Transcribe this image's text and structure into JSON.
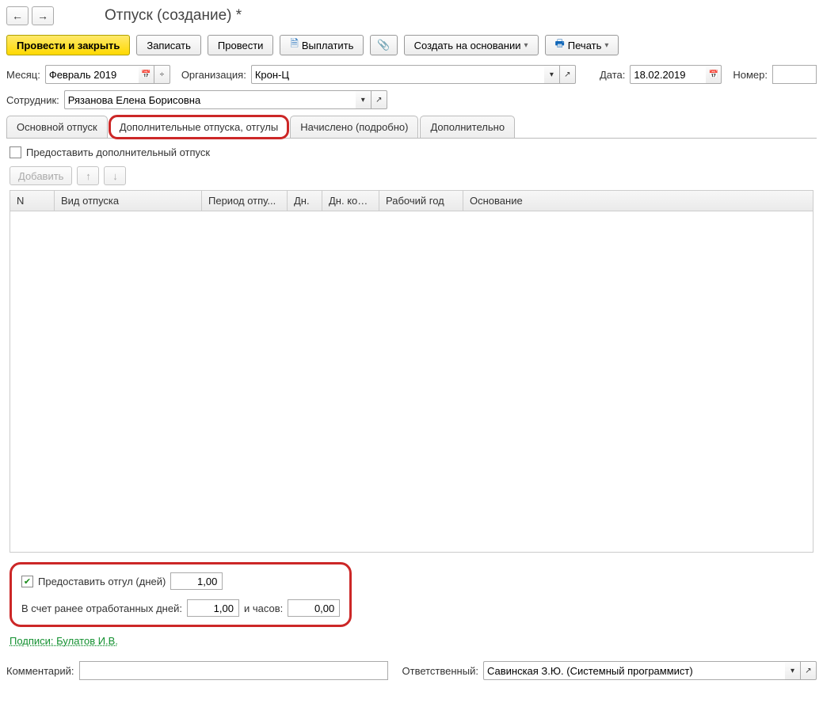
{
  "title": "Отпуск (создание) *",
  "toolbar": {
    "post_close": "Провести и закрыть",
    "write": "Записать",
    "post": "Провести",
    "payout": "Выплатить",
    "create_based": "Создать на основании",
    "print": "Печать"
  },
  "fields": {
    "month_label": "Месяц:",
    "month_value": "Февраль 2019",
    "org_label": "Организация:",
    "org_value": "Крон-Ц",
    "date_label": "Дата:",
    "date_value": "18.02.2019",
    "number_label": "Номер:",
    "number_value": "",
    "employee_label": "Сотрудник:",
    "employee_value": "Рязанова Елена Борисовна"
  },
  "tabs": {
    "main": "Основной отпуск",
    "additional": "Дополнительные отпуска, отгулы",
    "accrued": "Начислено (подробно)",
    "extra": "Дополнительно"
  },
  "content": {
    "provide_additional": "Предоставить дополнительный отпуск",
    "add_btn": "Добавить"
  },
  "table": {
    "cols": {
      "n": "N",
      "type": "Вид отпуска",
      "period": "Период отпу...",
      "days": "Дн.",
      "comp_days": "Дн. комп.",
      "work_year": "Рабочий год",
      "basis": "Основание"
    }
  },
  "bottom": {
    "provide_off_label": "Предоставить отгул (дней)",
    "provide_off_value": "1,00",
    "prev_days_label": "В счет ранее отработанных дней:",
    "prev_days_value": "1,00",
    "hours_label": "и часов:",
    "hours_value": "0,00"
  },
  "signatures": "Подписи: Булатов И.В.",
  "footer": {
    "comment_label": "Комментарий:",
    "comment_value": "",
    "responsible_label": "Ответственный:",
    "responsible_value": "Савинская З.Ю. (Системный программист)"
  }
}
